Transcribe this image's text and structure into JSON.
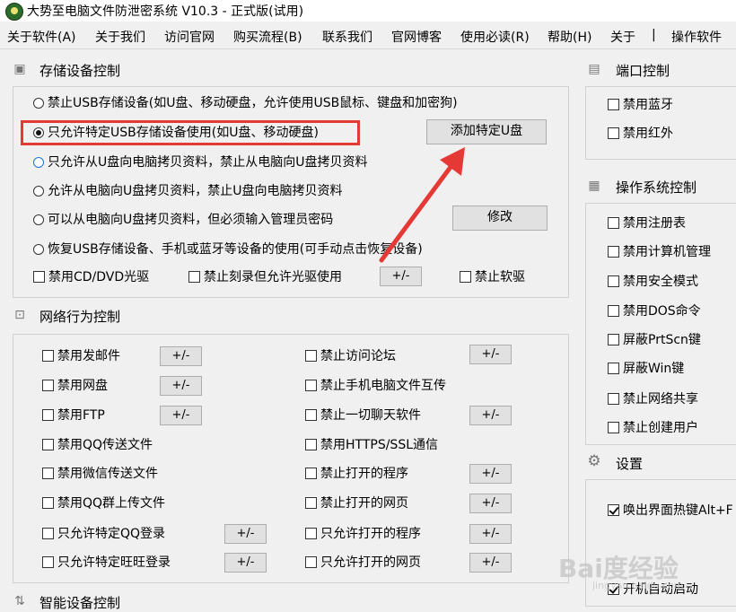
{
  "title": "大势至电脑文件防泄密系统 V10.3 - 正式版(试用)",
  "menu": [
    "关于软件(A)",
    "关于我们",
    "访问官网",
    "购买流程(B)",
    "联系我们",
    "官网博客",
    "使用必读(R)",
    "帮助(H)",
    "关于",
    "|",
    "操作软件"
  ],
  "storage": {
    "title": "存储设备控制",
    "options": [
      "禁止USB存储设备(如U盘、移动硬盘，允许使用USB鼠标、键盘和加密狗)",
      "只允许特定USB存储设备使用(如U盘、移动硬盘)",
      "只允许从U盘向电脑拷贝资料，禁止从电脑向U盘拷贝资料",
      "允许从电脑向U盘拷贝资料，禁止U盘向电脑拷贝资料",
      "可以从电脑向U盘拷贝资料，但必须输入管理员密码",
      "恢复USB存储设备、手机或蓝牙等设备的使用(可手动点击恢复设备)"
    ],
    "add_button": "添加特定U盘",
    "modify_button": "修改",
    "cd": "禁用CD/DVD光驱",
    "burn": "禁止刻录但允许光驱使用",
    "floppy": "禁止软驱",
    "pm": "+/-"
  },
  "network": {
    "title": "网络行为控制",
    "left": [
      "禁用发邮件",
      "禁用网盘",
      "禁用FTP",
      "禁用QQ传送文件",
      "禁用微信传送文件",
      "禁用QQ群上传文件",
      "只允许特定QQ登录",
      "只允许特定旺旺登录"
    ],
    "right": [
      "禁止访问论坛",
      "禁止手机电脑文件互传",
      "禁止一切聊天软件",
      "禁用HTTPS/SSL通信",
      "禁止打开的程序",
      "禁止打开的网页",
      "只允许打开的程序",
      "只允许打开的网页"
    ],
    "pm": "+/-"
  },
  "smart": {
    "title": "智能设备控制"
  },
  "port": {
    "title": "端口控制",
    "items": [
      "禁用蓝牙",
      "禁用红外"
    ]
  },
  "os": {
    "title": "操作系统控制",
    "items": [
      "禁用注册表",
      "禁用计算机管理",
      "禁用安全模式",
      "禁用DOS命令",
      "屏蔽PrtScn键",
      "屏蔽Win键",
      "禁止网络共享",
      "禁止创建用户"
    ]
  },
  "settings": {
    "title": "设置",
    "hotkey": "唤出界面热键Alt+F",
    "autostart": "开机自动启动"
  },
  "watermark": {
    "main": "Bai度经验",
    "sub": "jingyan.baidu.com"
  },
  "colors": {
    "highlight": "#e53935",
    "arrow": "#e53935"
  }
}
